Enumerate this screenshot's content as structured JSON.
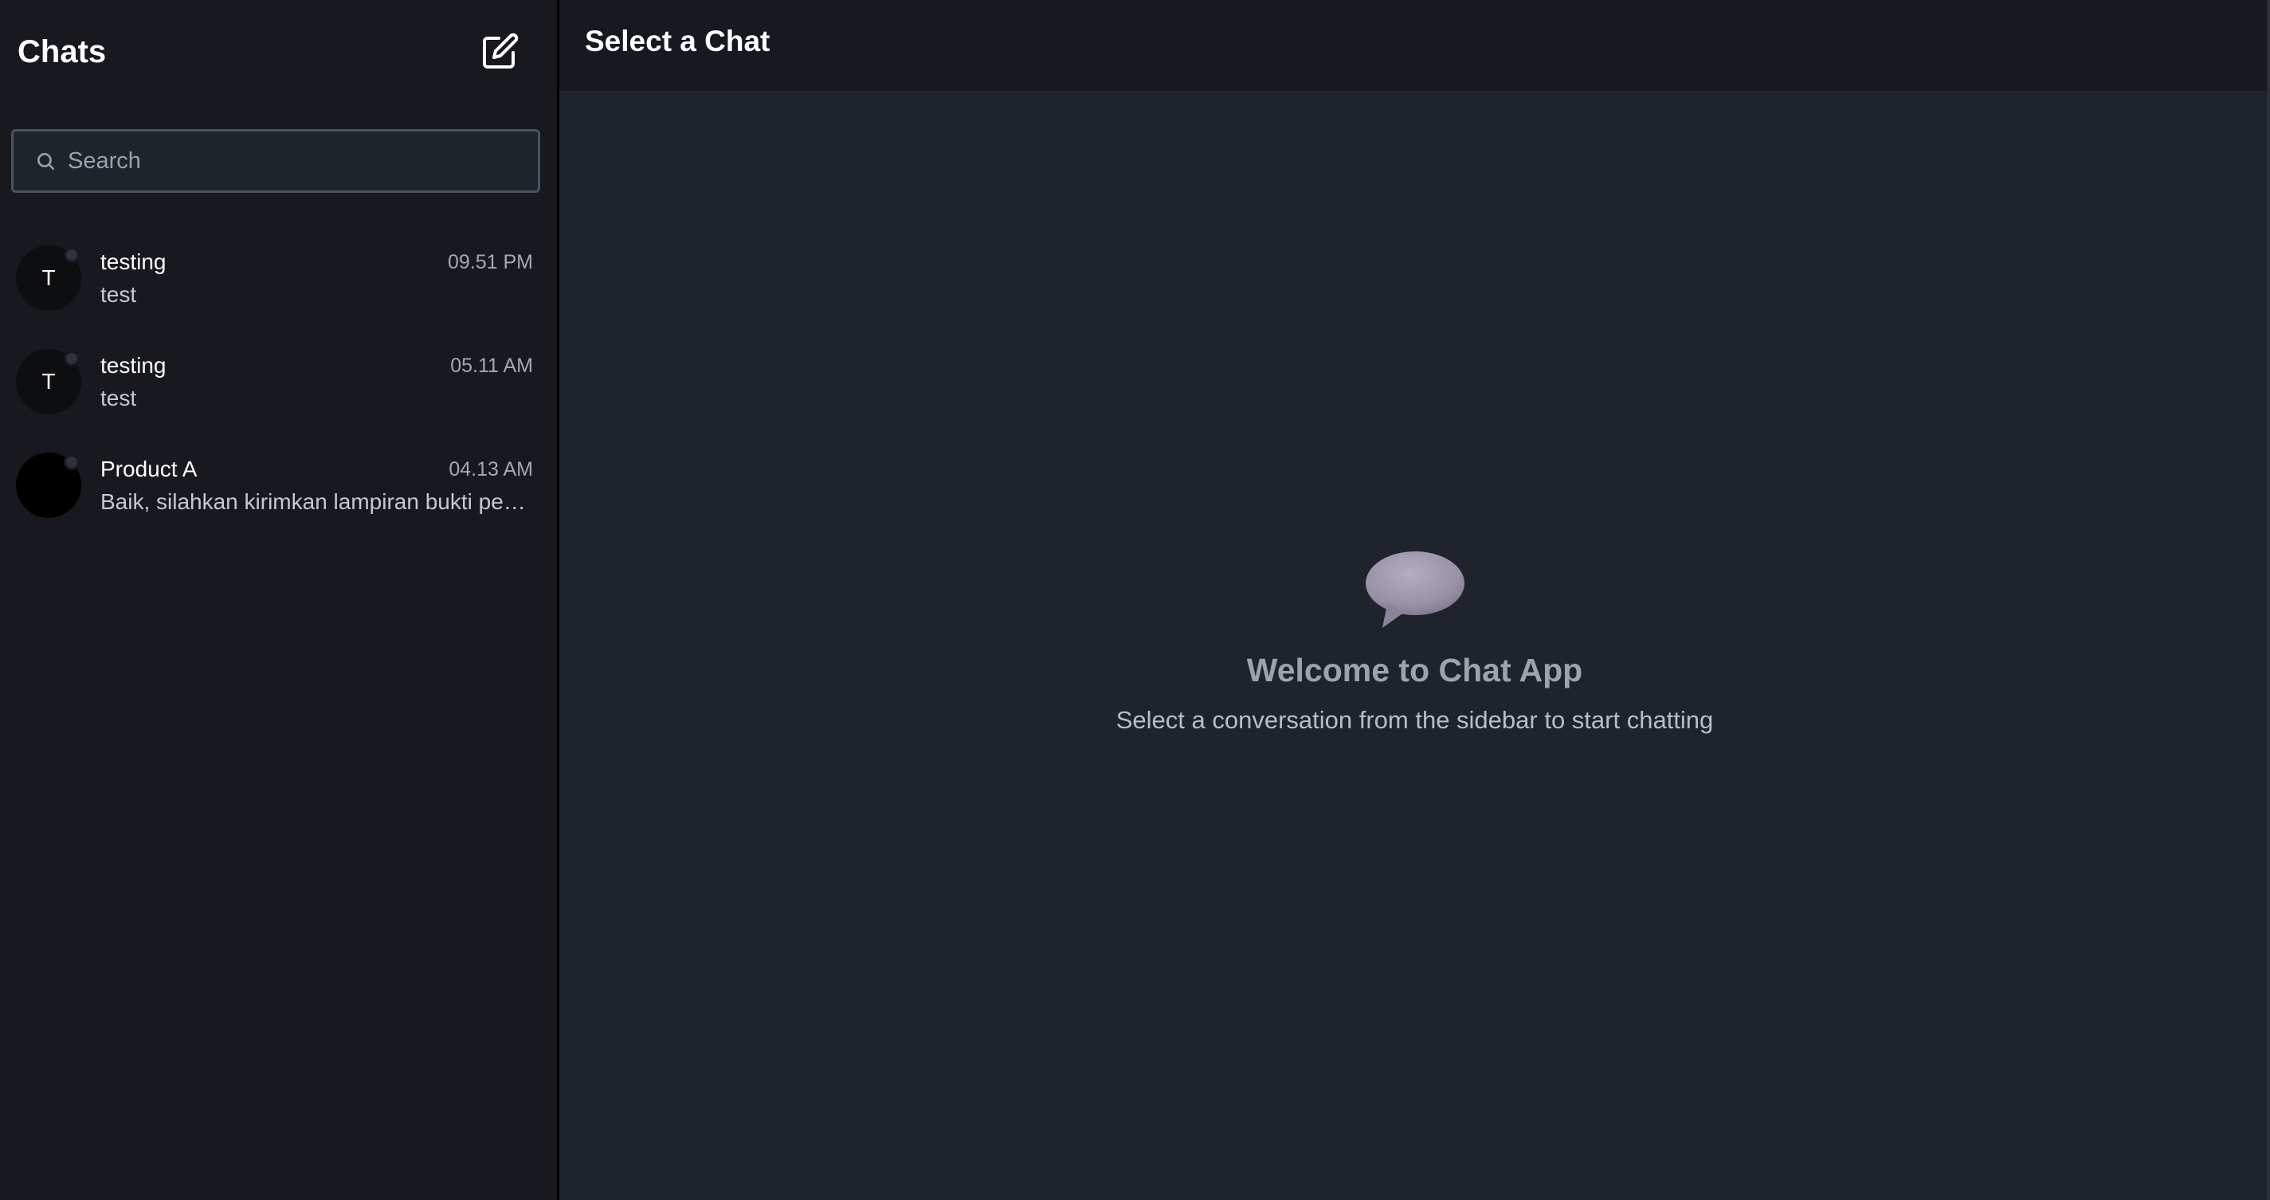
{
  "sidebar": {
    "title": "Chats",
    "new_chat_icon": "compose-icon",
    "search": {
      "placeholder": "Search",
      "value": "",
      "icon": "search-icon"
    },
    "chats": [
      {
        "avatar_initial": "T",
        "name": "testing",
        "time": "09.51 PM",
        "preview": "test"
      },
      {
        "avatar_initial": "T",
        "name": "testing",
        "time": "05.11 AM",
        "preview": "test"
      },
      {
        "avatar_initial": "",
        "name": "Product A",
        "time": "04.13 AM",
        "preview": "Baik, silahkan kirimkan lampiran bukti pe…"
      }
    ]
  },
  "main": {
    "title": "Select a Chat",
    "welcome": {
      "icon": "speech-bubble-icon",
      "title": "Welcome to Chat App",
      "subtitle": "Select a conversation from the sidebar to start chatting"
    }
  },
  "colors": {
    "sidebar_bg": "#17191f",
    "main_bg": "#1f232b",
    "header_bg": "#16191f",
    "text_primary": "#ffffff",
    "text_muted": "#9ca3af"
  }
}
